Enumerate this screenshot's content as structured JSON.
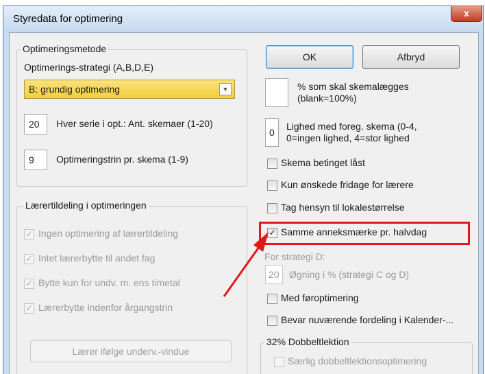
{
  "window": {
    "title": "Styredata for optimering",
    "close_label": "x"
  },
  "optimering": {
    "legend": "Optimeringsmetode",
    "strategy_label": "Optimerings-strategi (A,B,D,E)",
    "strategy_value": "B: grundig optimering",
    "serie_value": "20",
    "serie_label": "Hver serie i opt.: Ant. skemaer (1-20)",
    "trin_value": "9",
    "trin_label": "Optimeringstrin pr. skema (1-9)"
  },
  "laerer": {
    "legend": "Lærertildeling i optimeringen",
    "items": [
      {
        "label": "Ingen optimering af lærertildeling",
        "checked": "✓"
      },
      {
        "label": "Intet lærerbytte til andet fag",
        "checked": "✓"
      },
      {
        "label": "Bytte kun for undv. m. ens timetal",
        "checked": "✓"
      },
      {
        "label": "Lærerbytte indenfor årgangstrin",
        "checked": "✓"
      }
    ],
    "button_label": "Lærer ifølge underv.-vindue"
  },
  "buttons": {
    "ok": "OK",
    "cancel": "Afbryd"
  },
  "right": {
    "pct_value": "",
    "pct_label_line1": "% som skal skemalægges",
    "pct_label_line2": "(blank=100%)",
    "lighed_value": "0",
    "lighed_label_line1": "Lighed med foreg. skema (0-4,",
    "lighed_label_line2": "0=ingen lighed, 4=stor lighed",
    "checks": [
      {
        "label": "Skema betinget låst",
        "checked": ""
      },
      {
        "label": "Kun ønskede fridage for lærere",
        "checked": ""
      },
      {
        "label": "Tag hensyn til lokalestørrelse",
        "checked": ""
      },
      {
        "label": "Samme anneksmærke pr. halvdag",
        "checked": "✓"
      }
    ],
    "strategy_d_label": "For strategi D:",
    "ogning_value": "20",
    "ogning_label": "Øgning i % (strategi C og D)",
    "checks2": [
      {
        "label": "Med føroptimering",
        "checked": ""
      },
      {
        "label": "Bevar nuværende fordeling i Kalender-...",
        "checked": ""
      }
    ],
    "dobbelt_legend": "32% Dobbeltlektion",
    "dobbelt_check": "Særlig dobbeltlektionsoptimering"
  },
  "colors": {
    "highlight": "#e0181b",
    "combo": "#f2cf3b",
    "arrow": "#e0181b"
  }
}
